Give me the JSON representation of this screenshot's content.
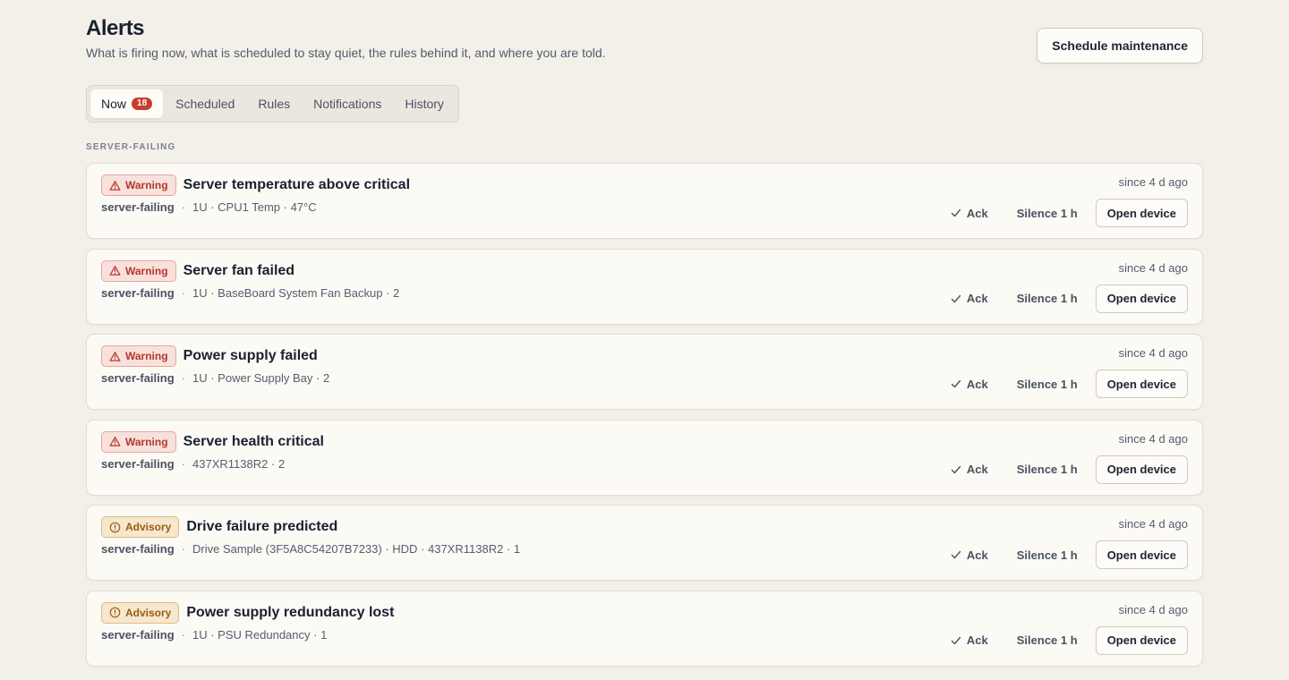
{
  "header": {
    "title": "Alerts",
    "subtitle": "What is firing now, what is scheduled to stay quiet, the rules behind it, and where you are told.",
    "schedule_label": "Schedule maintenance"
  },
  "tabs": [
    {
      "label": "Now",
      "count": "18"
    },
    {
      "label": "Scheduled"
    },
    {
      "label": "Rules"
    },
    {
      "label": "Notifications"
    },
    {
      "label": "History"
    }
  ],
  "section_label": "SERVER-FAILING",
  "colors": {
    "warning": "#b3382c",
    "advisory": "#9a5d10",
    "badge": "#c63d2f"
  },
  "alerts": [
    {
      "severity": "Warning",
      "severity_icon": "warning-triangle-icon",
      "title": "Server temperature above critical",
      "group": "server-failing",
      "detail": "1U · CPU1 Temp · 47°C",
      "since": "since 4 d ago",
      "ack_label": "Ack",
      "silence_label": "Silence 1 h",
      "open_label": "Open device"
    },
    {
      "severity": "Warning",
      "severity_icon": "warning-triangle-icon",
      "title": "Server fan failed",
      "group": "server-failing",
      "detail": "1U · BaseBoard System Fan Backup · 2",
      "since": "since 4 d ago",
      "ack_label": "Ack",
      "silence_label": "Silence 1 h",
      "open_label": "Open device"
    },
    {
      "severity": "Warning",
      "severity_icon": "warning-triangle-icon",
      "title": "Power supply failed",
      "group": "server-failing",
      "detail": "1U · Power Supply Bay · 2",
      "since": "since 4 d ago",
      "ack_label": "Ack",
      "silence_label": "Silence 1 h",
      "open_label": "Open device"
    },
    {
      "severity": "Warning",
      "severity_icon": "warning-triangle-icon",
      "title": "Server health critical",
      "group": "server-failing",
      "detail": "437XR1138R2 · 2",
      "since": "since 4 d ago",
      "ack_label": "Ack",
      "silence_label": "Silence 1 h",
      "open_label": "Open device"
    },
    {
      "severity": "Advisory",
      "severity_icon": "info-circle-icon",
      "title": "Drive failure predicted",
      "group": "server-failing",
      "detail": "Drive Sample (3F5A8C54207B7233) · HDD · 437XR1138R2 · 1",
      "since": "since 4 d ago",
      "ack_label": "Ack",
      "silence_label": "Silence 1 h",
      "open_label": "Open device"
    },
    {
      "severity": "Advisory",
      "severity_icon": "info-circle-icon",
      "title": "Power supply redundancy lost",
      "group": "server-failing",
      "detail": "1U · PSU Redundancy · 1",
      "since": "since 4 d ago",
      "ack_label": "Ack",
      "silence_label": "Silence 1 h",
      "open_label": "Open device"
    }
  ]
}
